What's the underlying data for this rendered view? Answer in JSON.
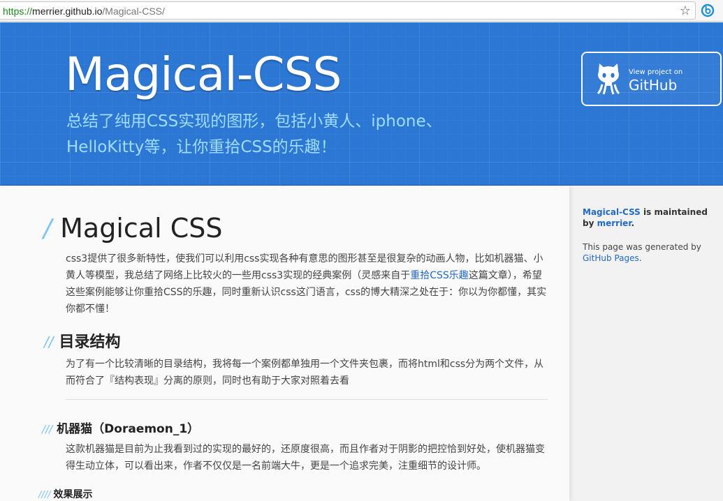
{
  "browser": {
    "url_scheme": "https://",
    "url_host": "merrier.github.io",
    "url_path": "/Magical-CSS/",
    "star_icon": "star-icon",
    "extension_icon": "extension-icon"
  },
  "header": {
    "title": "Magical-CSS",
    "tagline": "总结了纯用CSS实现的图形，包括小黄人、iphone、HelloKitty等，让你重拾CSS的乐趣！",
    "github_button": {
      "small": "View project on",
      "big": "GitHub",
      "icon": "octocat-icon"
    }
  },
  "main": {
    "h1": {
      "marker": "/",
      "text": "Magical CSS"
    },
    "intro": {
      "before": "css3提供了很多新特性，使我们可以利用css实现各种有意思的图形甚至是很复杂的动画人物，比如机器猫、小黄人等模型，我总结了网络上比较火的一些用css3实现的经典案例（灵感来自于",
      "link": "重拾CSS乐趣",
      "after": "这篇文章），希望这些案例能够让你重拾CSS的乐趣，同时重新认识css这门语言，css的博大精深之处在于：你以为你都懂，其实你都不懂！"
    },
    "h2": {
      "marker": "//",
      "text": "目录结构"
    },
    "structure_text": "为了有一个比较清晰的目录结构，我将每一个案例都单独用一个文件夹包裹，而将html和css分为两个文件，从而符合了『结构表现』分离的原则，同时也有助于大家对照着去看",
    "h3": {
      "marker": "///",
      "text": "机器猫（Doraemon_1）"
    },
    "doraemon_text": "这款机器猫是目前为止我看到过的实现的最好的，还原度很高，而且作者对于阴影的把控恰到好处，使机器猫变得生动立体，可以看出来，作者不仅仅是一名前端大牛，更是一个追求完美，注重细节的设计师。",
    "h4": {
      "marker": "////",
      "text": "效果展示"
    }
  },
  "sidebar": {
    "project_link": "Magical-CSS",
    "maintained_by": " is maintained by ",
    "author_link": "merrier",
    "period": ".",
    "generated_prefix": "This page was generated by ",
    "generated_link": "GitHub Pages",
    "generated_suffix": "."
  },
  "colors": {
    "header_blue": "#2c77d4",
    "tagline": "#9fdcff",
    "link": "#2369c6",
    "marker": "#7ec4f4"
  }
}
